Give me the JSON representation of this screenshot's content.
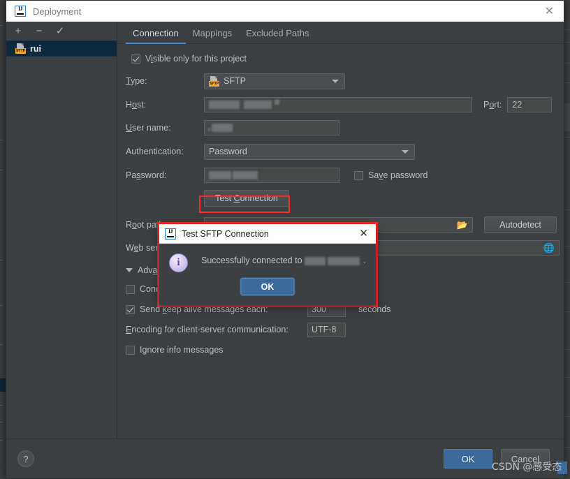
{
  "window": {
    "title": "Deployment",
    "logo_icon": "intellij-idea-logo-icon",
    "close_icon": "close-icon"
  },
  "server_list": {
    "toolbar": [
      {
        "name": "add-server-button",
        "icon": "plus-icon",
        "glyph": "+"
      },
      {
        "name": "remove-server-button",
        "icon": "minus-icon",
        "glyph": "−"
      },
      {
        "name": "set-default-server-button",
        "icon": "check-icon",
        "glyph": "✓"
      }
    ],
    "items": [
      {
        "label": "rui",
        "icon": "sftp-server-icon",
        "badge": "SFTP",
        "selected": true
      }
    ]
  },
  "tabs": [
    {
      "label": "Connection",
      "active": true
    },
    {
      "label": "Mappings",
      "active": false
    },
    {
      "label": "Excluded Paths",
      "active": false
    }
  ],
  "connection": {
    "visible_only_checkbox": {
      "label_pre": "V",
      "label_u": "i",
      "label_post": "sible only for this project",
      "checked": true
    },
    "type": {
      "label": "Type:",
      "label_u": "T",
      "value": "SFTP",
      "icon": "sftp-icon",
      "badge": "SFTP"
    },
    "host": {
      "label_pre": "H",
      "label_u": "o",
      "label_post": "st:",
      "value": "",
      "redacted": true
    },
    "port": {
      "label_pre": "P",
      "label_u": "o",
      "label_post": "rt:",
      "value": "22"
    },
    "user_name": {
      "label_pre": "",
      "label_u": "U",
      "label_post": "ser name:",
      "value": "",
      "redacted": true
    },
    "authentication": {
      "label": "Authentication:",
      "value": "Password"
    },
    "password": {
      "label_pre": "Pa",
      "label_u": "s",
      "label_post": "sword:",
      "value": "",
      "redacted": true
    },
    "save_password": {
      "label_pre": "Sa",
      "label_u": "v",
      "label_post": "e password",
      "checked": false
    },
    "test_connection_button": {
      "label_pre": "Test ",
      "label_u": "C",
      "label_post": "onnection",
      "highlighted": true
    },
    "root_path": {
      "label_pre": "R",
      "label_u": "o",
      "label_post": "ot path:",
      "value": "",
      "browse_icon": "folder-icon"
    },
    "autodetect_button": {
      "label": "Autodetect"
    },
    "web_server_url": {
      "label_pre": "W",
      "label_u": "e",
      "label_post": "b server URL:",
      "value": "",
      "open_icon": "globe-icon"
    }
  },
  "advanced": {
    "header": {
      "label_pre": "Adv",
      "label_u": "a",
      "label_post": "nced",
      "expanded": true,
      "toggle_icon": "chevron-down-icon"
    },
    "concurrent_connections": {
      "label": "Concurrent connections limit:",
      "checked": false,
      "value": ""
    },
    "keep_alive": {
      "label_pre": "Send ",
      "label_u": "k",
      "label_post": "eep alive messages each:",
      "checked": true,
      "value": "300",
      "unit": "seconds"
    },
    "encoding": {
      "label_pre": "",
      "label_u": "E",
      "label_post": "ncoding for client-server communication:",
      "value": "UTF-8"
    },
    "ignore_info": {
      "label_pre": "I",
      "label_u": "g",
      "label_post": "nore info messages",
      "checked": false
    }
  },
  "footer": {
    "help_button": {
      "label": "?",
      "icon": "help-icon"
    },
    "ok_button": {
      "label": "OK"
    },
    "cancel_button": {
      "label": "Cancel"
    }
  },
  "modal": {
    "title": "Test SFTP Connection",
    "logo_icon": "intellij-idea-logo-icon",
    "close_icon": "close-icon",
    "info_icon": "info-icon",
    "message_pre": "Successfully connected to",
    "message_post": ".",
    "ok_button": {
      "label": "OK"
    },
    "highlighted": true
  },
  "watermark": {
    "text": "CSDN @感受态"
  },
  "colors": {
    "panel_bg": "#3c3f41",
    "selection_blue": "#0d293e",
    "accent_blue": "#4a88c7",
    "primary_button": "#3c6a9b",
    "highlight_red": "#fc2a2a",
    "sftp_badge": "#f0a732"
  }
}
